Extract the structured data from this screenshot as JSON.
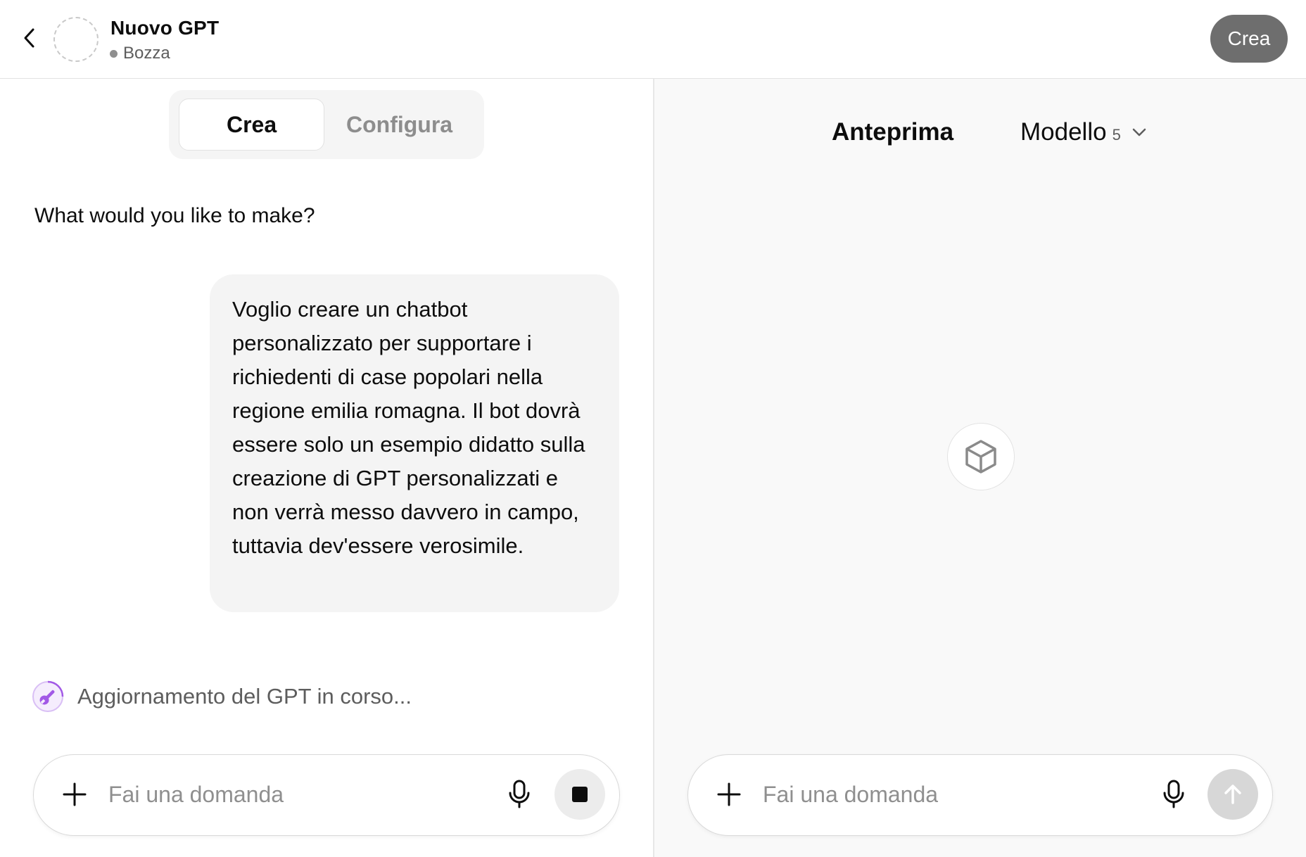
{
  "header": {
    "title": "Nuovo GPT",
    "status": "Bozza",
    "create_button": "Crea"
  },
  "tabs": {
    "create": "Crea",
    "configure": "Configura"
  },
  "conversation": {
    "assistant_message": "What would you like to make?",
    "user_message": "Voglio creare un chatbot personalizzato per supportare i richiedenti di case popolari nella regione emilia romagna. Il bot dovrà essere solo un esempio didatto sulla creazione di GPT personalizzati e non verrà messo davvero in campo, tuttavia dev'essere verosimile.",
    "status_text": "Aggiornamento del GPT in corso..."
  },
  "left_composer": {
    "placeholder": "Fai una domanda"
  },
  "preview": {
    "title": "Anteprima",
    "model_label": "Modello",
    "model_version": "5"
  },
  "right_composer": {
    "placeholder": "Fai una domanda"
  },
  "colors": {
    "accent_purple": "#a259e6",
    "button_gray": "#6e6e6e"
  }
}
